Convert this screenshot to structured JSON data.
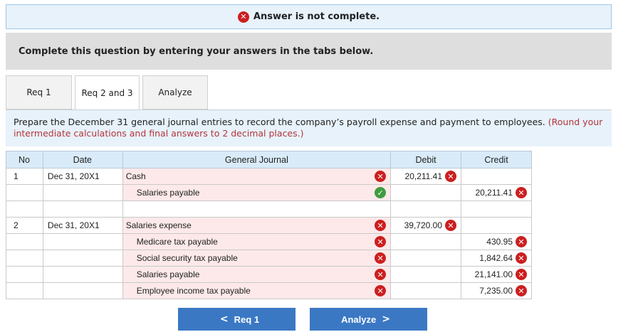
{
  "banner": {
    "message": "Answer is not complete.",
    "icon": "x-circle-icon",
    "icon_color": "#cc1f1f"
  },
  "instructions": "Complete this question by entering your answers in the tabs below.",
  "tabs": [
    {
      "label": "Req 1",
      "active": false
    },
    {
      "label": "Req 2 and 3",
      "active": true
    },
    {
      "label": "Analyze",
      "active": false
    }
  ],
  "prompt": {
    "text": "Prepare the December 31 general journal entries to record the company’s payroll expense and payment to employees.",
    "note": "(Round your intermediate calculations and final answers to 2 decimal places.)"
  },
  "table": {
    "headers": {
      "no": "No",
      "date": "Date",
      "journal": "General Journal",
      "debit": "Debit",
      "credit": "Credit"
    },
    "rows": [
      {
        "no": "1",
        "date": "Dec 31, 20X1",
        "account": "Cash",
        "indent": false,
        "account_status": "wrong",
        "debit": "20,211.41",
        "debit_status": "wrong",
        "credit": "",
        "credit_status": ""
      },
      {
        "no": "",
        "date": "",
        "account": "Salaries payable",
        "indent": true,
        "account_status": "correct",
        "debit": "",
        "debit_status": "",
        "credit": "20,211.41",
        "credit_status": "wrong"
      },
      {
        "no": "",
        "date": "",
        "account": "",
        "indent": false,
        "account_status": "",
        "debit": "",
        "debit_status": "",
        "credit": "",
        "credit_status": "",
        "blank": true
      },
      {
        "no": "2",
        "date": "Dec 31, 20X1",
        "account": "Salaries expense",
        "indent": false,
        "account_status": "wrong",
        "debit": "39,720.00",
        "debit_status": "wrong",
        "credit": "",
        "credit_status": ""
      },
      {
        "no": "",
        "date": "",
        "account": "Medicare tax payable",
        "indent": true,
        "account_status": "wrong",
        "debit": "",
        "debit_status": "",
        "credit": "430.95",
        "credit_status": "wrong"
      },
      {
        "no": "",
        "date": "",
        "account": "Social security tax payable",
        "indent": true,
        "account_status": "wrong",
        "debit": "",
        "debit_status": "",
        "credit": "1,842.64",
        "credit_status": "wrong"
      },
      {
        "no": "",
        "date": "",
        "account": "Salaries payable",
        "indent": true,
        "account_status": "wrong",
        "debit": "",
        "debit_status": "",
        "credit": "21,141.00",
        "credit_status": "wrong"
      },
      {
        "no": "",
        "date": "",
        "account": "Employee income tax payable",
        "indent": true,
        "account_status": "wrong",
        "debit": "",
        "debit_status": "",
        "credit": "7,235.00",
        "credit_status": "wrong"
      }
    ]
  },
  "nav": {
    "prev_label": "Req 1",
    "next_label": "Analyze",
    "button_color": "#3b78c4"
  },
  "colors": {
    "wrong": "#cc1f1f",
    "correct": "#3f9c3f",
    "account_bg": "#fde9e9",
    "header_bg": "#d9ebf8",
    "note": "#b5343a"
  }
}
